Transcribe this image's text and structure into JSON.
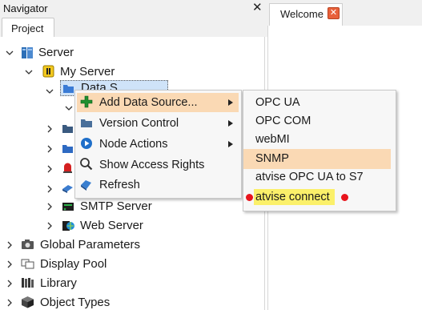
{
  "navigator": {
    "title": "Navigator",
    "close_glyph": "✕"
  },
  "project_tab": {
    "label": "Project"
  },
  "welcome_tab": {
    "label": "Welcome",
    "close_glyph": "✕"
  },
  "tree": {
    "server": "Server",
    "my_server": "My Server",
    "data_sources": "Data S...",
    "smtp_server": "SMTP Server",
    "web_server": "Web Server",
    "global_parameters": "Global Parameters",
    "display_pool": "Display Pool",
    "library": "Library",
    "object_types": "Object Types"
  },
  "context_menu": {
    "items": [
      {
        "label": "Add Data Source...",
        "icon": "green-plus-icon",
        "has_submenu": true
      },
      {
        "label": "Version Control",
        "icon": "folder-icon",
        "has_submenu": true
      },
      {
        "label": "Node Actions",
        "icon": "play-circle-icon",
        "has_submenu": true
      },
      {
        "label": "Show Access Rights",
        "icon": "magnifier-icon",
        "has_submenu": false
      },
      {
        "label": "Refresh",
        "icon": "refresh-icon",
        "has_submenu": false
      }
    ]
  },
  "submenu": {
    "items": [
      {
        "label": "OPC UA"
      },
      {
        "label": "OPC COM"
      },
      {
        "label": "webMI"
      },
      {
        "label": "SNMP"
      },
      {
        "label": "atvise OPC UA to S7"
      },
      {
        "label": "atvise connect"
      }
    ]
  },
  "colors": {
    "menu_highlight": "#fad9b4",
    "annotation_yellow": "#fbf06a",
    "annotation_dot": "#e8141c"
  }
}
